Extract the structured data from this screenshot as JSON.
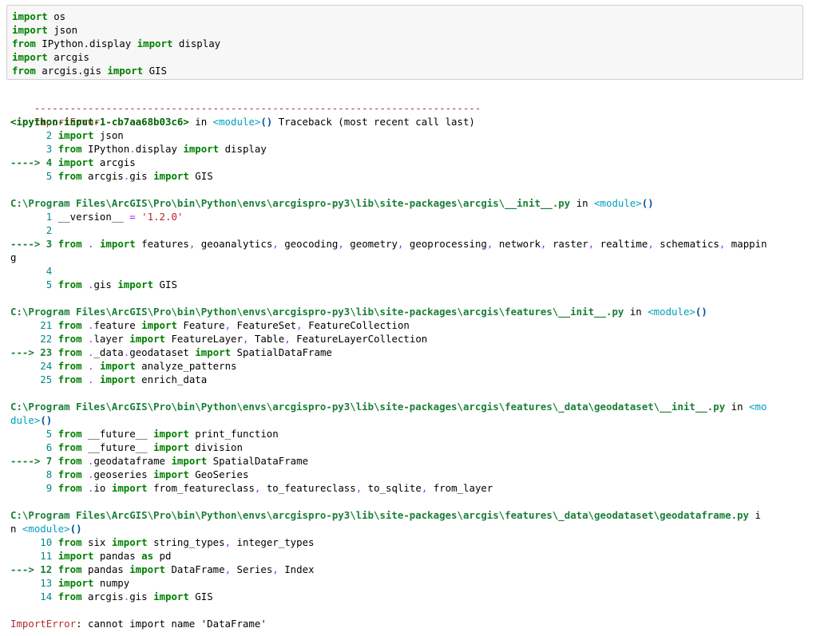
{
  "input_cell": {
    "lines": [
      [
        [
          "kw",
          "import"
        ],
        [
          "t",
          " os"
        ]
      ],
      [
        [
          "kw",
          "import"
        ],
        [
          "t",
          " json"
        ]
      ],
      [
        [
          "kw",
          "from"
        ],
        [
          "t",
          " IPython.display "
        ],
        [
          "kw",
          "import"
        ],
        [
          "t",
          " display"
        ]
      ],
      [
        [
          "kw",
          "import"
        ],
        [
          "t",
          " arcgis"
        ]
      ],
      [
        [
          "kw",
          "from"
        ],
        [
          "t",
          " arcgis.gis "
        ],
        [
          "kw",
          "import"
        ],
        [
          "t",
          " GIS"
        ]
      ]
    ]
  },
  "output": {
    "separator": "---------------------------------------------------------------------------",
    "error_name": "ImportError",
    "traceback_header": "                              Traceback (most recent call last)",
    "frames": [
      {
        "location": [
          [
            "tb-loc",
            "<ipython-input-1-cb7aa68b03c6>"
          ],
          [
            "t",
            " in "
          ],
          [
            "mod",
            "<module>"
          ],
          [
            "paren",
            "()"
          ]
        ],
        "lines": [
          [
            [
              "num",
              "      2 "
            ],
            [
              "kw",
              "import"
            ],
            [
              "t",
              " json"
            ]
          ],
          [
            [
              "num",
              "      3 "
            ],
            [
              "kw",
              "from"
            ],
            [
              "t",
              " IPython"
            ],
            [
              "op",
              "."
            ],
            [
              "t",
              "display "
            ],
            [
              "kw",
              "import"
            ],
            [
              "t",
              " display"
            ]
          ],
          [
            [
              "arrow",
              "----> 4 "
            ],
            [
              "kw",
              "import"
            ],
            [
              "t",
              " arcgis"
            ]
          ],
          [
            [
              "num",
              "      5 "
            ],
            [
              "kw",
              "from"
            ],
            [
              "t",
              " arcgis"
            ],
            [
              "op",
              "."
            ],
            [
              "t",
              "gis "
            ],
            [
              "kw",
              "import"
            ],
            [
              "t",
              " GIS"
            ]
          ]
        ]
      },
      {
        "location": [
          [
            "path",
            "C:\\Program Files\\ArcGIS\\Pro\\bin\\Python\\envs\\arcgispro-py3\\lib\\site-packages\\arcgis\\__init__.py"
          ],
          [
            "t",
            " in "
          ],
          [
            "mod",
            "<module>"
          ],
          [
            "paren",
            "()"
          ]
        ],
        "lines": [
          [
            [
              "num",
              "      1 "
            ],
            [
              "t",
              "__version__ "
            ],
            [
              "op",
              "="
            ],
            [
              "t",
              " "
            ],
            [
              "str",
              "'1.2.0'"
            ]
          ],
          [
            [
              "num",
              "      2 "
            ]
          ],
          [
            [
              "arrow",
              "----> 3 "
            ],
            [
              "kw",
              "from"
            ],
            [
              "t",
              " "
            ],
            [
              "op",
              "."
            ],
            [
              "t",
              " "
            ],
            [
              "kw",
              "import"
            ],
            [
              "t",
              " features"
            ],
            [
              "op",
              ","
            ],
            [
              "t",
              " geoanalytics"
            ],
            [
              "op",
              ","
            ],
            [
              "t",
              " geocoding"
            ],
            [
              "op",
              ","
            ],
            [
              "t",
              " geometry"
            ],
            [
              "op",
              ","
            ],
            [
              "t",
              " geoprocessing"
            ],
            [
              "op",
              ","
            ],
            [
              "t",
              " network"
            ],
            [
              "op",
              ","
            ],
            [
              "t",
              " raster"
            ],
            [
              "op",
              ","
            ],
            [
              "t",
              " realtime"
            ],
            [
              "op",
              ","
            ],
            [
              "t",
              " schematics"
            ],
            [
              "op",
              ","
            ],
            [
              "t",
              " mappin"
            ]
          ],
          [
            [
              "t",
              "g"
            ]
          ],
          [
            [
              "num",
              "      4 "
            ]
          ],
          [
            [
              "num",
              "      5 "
            ],
            [
              "kw",
              "from"
            ],
            [
              "t",
              " "
            ],
            [
              "op",
              "."
            ],
            [
              "t",
              "gis "
            ],
            [
              "kw",
              "import"
            ],
            [
              "t",
              " GIS"
            ]
          ]
        ]
      },
      {
        "location": [
          [
            "path",
            "C:\\Program Files\\ArcGIS\\Pro\\bin\\Python\\envs\\arcgispro-py3\\lib\\site-packages\\arcgis\\features\\__init__.py"
          ],
          [
            "t",
            " in "
          ],
          [
            "mod",
            "<module>"
          ],
          [
            "paren",
            "()"
          ]
        ],
        "lines": [
          [
            [
              "num",
              "     21 "
            ],
            [
              "kw",
              "from"
            ],
            [
              "t",
              " "
            ],
            [
              "op",
              "."
            ],
            [
              "t",
              "feature "
            ],
            [
              "kw",
              "import"
            ],
            [
              "t",
              " Feature"
            ],
            [
              "op",
              ","
            ],
            [
              "t",
              " FeatureSet"
            ],
            [
              "op",
              ","
            ],
            [
              "t",
              " FeatureCollection"
            ]
          ],
          [
            [
              "num",
              "     22 "
            ],
            [
              "kw",
              "from"
            ],
            [
              "t",
              " "
            ],
            [
              "op",
              "."
            ],
            [
              "t",
              "layer "
            ],
            [
              "kw",
              "import"
            ],
            [
              "t",
              " FeatureLayer"
            ],
            [
              "op",
              ","
            ],
            [
              "t",
              " Table"
            ],
            [
              "op",
              ","
            ],
            [
              "t",
              " FeatureLayerCollection"
            ]
          ],
          [
            [
              "arrow",
              "---> 23 "
            ],
            [
              "kw",
              "from"
            ],
            [
              "t",
              " "
            ],
            [
              "op",
              "."
            ],
            [
              "t",
              "_data"
            ],
            [
              "op",
              "."
            ],
            [
              "t",
              "geodataset "
            ],
            [
              "kw",
              "import"
            ],
            [
              "t",
              " SpatialDataFrame"
            ]
          ],
          [
            [
              "num",
              "     24 "
            ],
            [
              "kw",
              "from"
            ],
            [
              "t",
              " "
            ],
            [
              "op",
              "."
            ],
            [
              "t",
              " "
            ],
            [
              "kw",
              "import"
            ],
            [
              "t",
              " analyze_patterns"
            ]
          ],
          [
            [
              "num",
              "     25 "
            ],
            [
              "kw",
              "from"
            ],
            [
              "t",
              " "
            ],
            [
              "op",
              "."
            ],
            [
              "t",
              " "
            ],
            [
              "kw",
              "import"
            ],
            [
              "t",
              " enrich_data"
            ]
          ]
        ]
      },
      {
        "location": [
          [
            "path",
            "C:\\Program Files\\ArcGIS\\Pro\\bin\\Python\\envs\\arcgispro-py3\\lib\\site-packages\\arcgis\\features\\_data\\geodataset\\__init__.py"
          ],
          [
            "t",
            " in "
          ],
          [
            "mod",
            "<mo"
          ]
        ],
        "location_wrap": [
          [
            "mod",
            "dule>"
          ],
          [
            "paren",
            "()"
          ]
        ],
        "lines": [
          [
            [
              "num",
              "      5 "
            ],
            [
              "kw",
              "from"
            ],
            [
              "t",
              " __future__ "
            ],
            [
              "kw",
              "import"
            ],
            [
              "t",
              " print_function"
            ]
          ],
          [
            [
              "num",
              "      6 "
            ],
            [
              "kw",
              "from"
            ],
            [
              "t",
              " __future__ "
            ],
            [
              "kw",
              "import"
            ],
            [
              "t",
              " division"
            ]
          ],
          [
            [
              "arrow",
              "----> 7 "
            ],
            [
              "kw",
              "from"
            ],
            [
              "t",
              " "
            ],
            [
              "op",
              "."
            ],
            [
              "t",
              "geodataframe "
            ],
            [
              "kw",
              "import"
            ],
            [
              "t",
              " SpatialDataFrame"
            ]
          ],
          [
            [
              "num",
              "      8 "
            ],
            [
              "kw",
              "from"
            ],
            [
              "t",
              " "
            ],
            [
              "op",
              "."
            ],
            [
              "t",
              "geoseries "
            ],
            [
              "kw",
              "import"
            ],
            [
              "t",
              " GeoSeries"
            ]
          ],
          [
            [
              "num",
              "      9 "
            ],
            [
              "kw",
              "from"
            ],
            [
              "t",
              " "
            ],
            [
              "op",
              "."
            ],
            [
              "t",
              "io "
            ],
            [
              "kw",
              "import"
            ],
            [
              "t",
              " from_featureclass"
            ],
            [
              "op",
              ","
            ],
            [
              "t",
              " to_featureclass"
            ],
            [
              "op",
              ","
            ],
            [
              "t",
              " to_sqlite"
            ],
            [
              "op",
              ","
            ],
            [
              "t",
              " from_layer"
            ]
          ]
        ]
      },
      {
        "location": [
          [
            "path",
            "C:\\Program Files\\ArcGIS\\Pro\\bin\\Python\\envs\\arcgispro-py3\\lib\\site-packages\\arcgis\\features\\_data\\geodataset\\geodataframe.py"
          ],
          [
            "t",
            " i"
          ]
        ],
        "location_wrap": [
          [
            "t",
            "n "
          ],
          [
            "mod",
            "<module>"
          ],
          [
            "paren",
            "()"
          ]
        ],
        "lines": [
          [
            [
              "num",
              "     10 "
            ],
            [
              "kw",
              "from"
            ],
            [
              "t",
              " six "
            ],
            [
              "kw",
              "import"
            ],
            [
              "t",
              " string_types"
            ],
            [
              "op",
              ","
            ],
            [
              "t",
              " integer_types"
            ]
          ],
          [
            [
              "num",
              "     11 "
            ],
            [
              "kw",
              "import"
            ],
            [
              "t",
              " pandas "
            ],
            [
              "kw",
              "as"
            ],
            [
              "t",
              " pd"
            ]
          ],
          [
            [
              "arrow",
              "---> 12 "
            ],
            [
              "kw",
              "from"
            ],
            [
              "t",
              " pandas "
            ],
            [
              "kw",
              "import"
            ],
            [
              "t",
              " DataFrame"
            ],
            [
              "op",
              ","
            ],
            [
              "t",
              " Series"
            ],
            [
              "op",
              ","
            ],
            [
              "t",
              " Index"
            ]
          ],
          [
            [
              "num",
              "     13 "
            ],
            [
              "kw",
              "import"
            ],
            [
              "t",
              " numpy"
            ]
          ],
          [
            [
              "num",
              "     14 "
            ],
            [
              "kw",
              "from"
            ],
            [
              "t",
              " arcgis"
            ],
            [
              "op",
              "."
            ],
            [
              "t",
              "gis "
            ],
            [
              "kw",
              "import"
            ],
            [
              "t",
              " GIS"
            ]
          ]
        ]
      }
    ],
    "final_error": [
      [
        "err",
        "ImportError"
      ],
      [
        "t",
        ": cannot import name 'DataFrame'"
      ]
    ]
  }
}
